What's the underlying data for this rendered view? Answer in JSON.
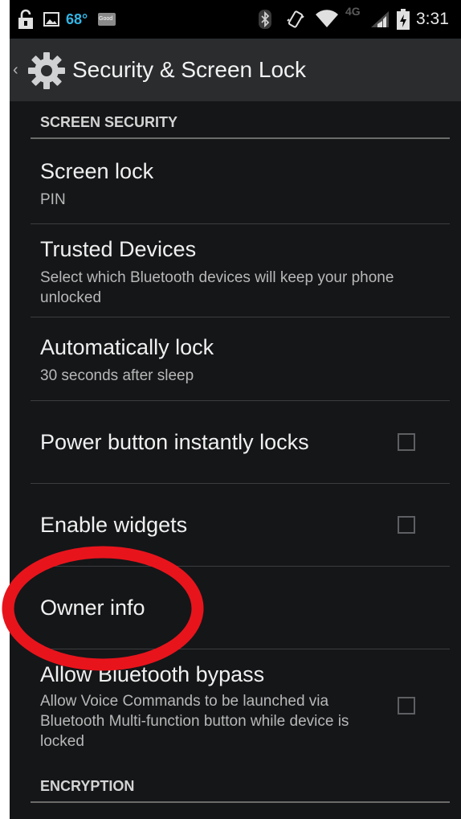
{
  "status_bar": {
    "temperature": "68°",
    "weather_badge": "Good",
    "network": "4G",
    "time": "3:31",
    "icons": [
      "unlock-icon",
      "image-icon",
      "bluetooth-icon",
      "vibrate-icon",
      "wifi-icon",
      "signal-icon",
      "battery-charging-icon"
    ]
  },
  "action_bar": {
    "up_icon": "chevron-left-icon",
    "app_icon": "gear-icon",
    "title": "Security & Screen Lock"
  },
  "categories": [
    {
      "label": "SCREEN SECURITY"
    },
    {
      "label": "ENCRYPTION"
    }
  ],
  "items": [
    {
      "title": "Screen lock",
      "summary": "PIN"
    },
    {
      "title": "Trusted Devices",
      "summary": "Select which Bluetooth devices will keep your phone unlocked"
    },
    {
      "title": "Automatically lock",
      "summary": "30 seconds after sleep"
    },
    {
      "title": "Power button instantly locks",
      "checked": false
    },
    {
      "title": "Enable widgets",
      "checked": false
    },
    {
      "title": "Owner info"
    },
    {
      "title": "Allow Bluetooth bypass",
      "summary": "Allow Voice Commands to be launched via Bluetooth Multi-function button while device is locked",
      "checked": false
    }
  ],
  "colors": {
    "background": "#151618",
    "action_bar": "#2a2c2e",
    "accent": "#33b5e5",
    "annotation": "#e8141c"
  }
}
